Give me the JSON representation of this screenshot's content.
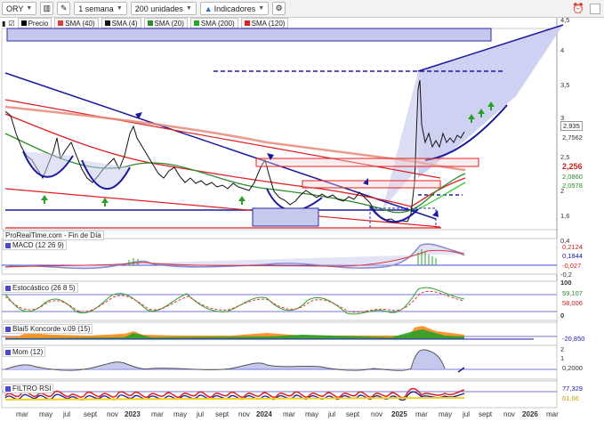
{
  "toolbar": {
    "symbol": "ORY",
    "timeframe": "1 semana",
    "units": "200 unidades",
    "indicators": "Indicadores"
  },
  "legend": [
    {
      "label": "Precio",
      "color": "#000000"
    },
    {
      "label": "SMA (40)",
      "color": "#e03a3a"
    },
    {
      "label": "SMA (4)",
      "color": "#111111"
    },
    {
      "label": "SMA (20)",
      "color": "#2e8b2e"
    },
    {
      "label": "SMA (200)",
      "color": "#22aa22"
    },
    {
      "label": "SMA (120)",
      "color": "#e02020"
    }
  ],
  "source_note": "ProRealTime.com - Fin de Día",
  "price_axis": [
    "4,5",
    "4",
    "3,5",
    "3",
    "2,5",
    "2",
    "1,6"
  ],
  "price_labels": [
    {
      "text": "2,935",
      "bg": "#ffffff",
      "fg": "#000000"
    },
    {
      "text": "2,7562",
      "bg": "#ffffff",
      "fg": "#333333"
    },
    {
      "text": "2,256",
      "bg": "#ffffff",
      "fg": "#d02020"
    },
    {
      "text": "2,0860",
      "bg": "#ffffff",
      "fg": "#2a8a2a"
    },
    {
      "text": "2,0578",
      "bg": "#ffffff",
      "fg": "#2a8a2a"
    }
  ],
  "panels": {
    "macd": {
      "label": "MACD (12 26 9)",
      "axis": [
        "0,4",
        "0,2",
        "-0,2"
      ],
      "values": [
        "0,2124",
        "0,1844",
        "-0,027"
      ]
    },
    "stoch": {
      "label": "Estocástico (26 8 5)",
      "axis": [
        "100",
        "0"
      ],
      "values": [
        "59,107",
        "58,006"
      ]
    },
    "koncorde": {
      "label": "Blai5 Koncorde v.09 (15)",
      "values": [
        "-20,850"
      ]
    },
    "mom": {
      "label": "Mom (12)",
      "axis": [
        "2",
        "1"
      ],
      "values": [
        "0,2000"
      ]
    },
    "rsi": {
      "label": "FILTRO RSI",
      "values": [
        "77,329",
        "61,66"
      ]
    }
  },
  "x_axis": [
    {
      "label": "mar",
      "bold": false
    },
    {
      "label": "may",
      "bold": false
    },
    {
      "label": "jul",
      "bold": false
    },
    {
      "label": "sept",
      "bold": false
    },
    {
      "label": "nov",
      "bold": false
    },
    {
      "label": "2023",
      "bold": true
    },
    {
      "label": "mar",
      "bold": false
    },
    {
      "label": "may",
      "bold": false
    },
    {
      "label": "jul",
      "bold": false
    },
    {
      "label": "sept",
      "bold": false
    },
    {
      "label": "nov",
      "bold": false
    },
    {
      "label": "2024",
      "bold": true
    },
    {
      "label": "mar",
      "bold": false
    },
    {
      "label": "may",
      "bold": false
    },
    {
      "label": "jul",
      "bold": false
    },
    {
      "label": "sept",
      "bold": false
    },
    {
      "label": "nov",
      "bold": false
    },
    {
      "label": "2025",
      "bold": true
    },
    {
      "label": "mar",
      "bold": false
    },
    {
      "label": "may",
      "bold": false
    },
    {
      "label": "jul",
      "bold": false
    },
    {
      "label": "sept",
      "bold": false
    },
    {
      "label": "nov",
      "bold": false
    },
    {
      "label": "2026",
      "bold": true
    },
    {
      "label": "mar",
      "bold": false
    }
  ]
}
